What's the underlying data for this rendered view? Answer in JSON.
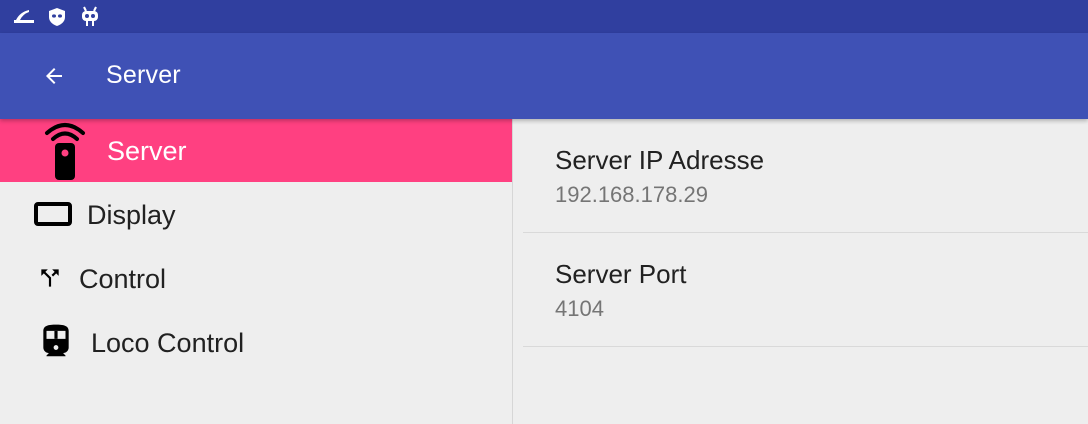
{
  "status_bar": {
    "icons": [
      "signal-strength-icon",
      "privacy-guard-icon",
      "android-debug-icon"
    ]
  },
  "app_bar": {
    "back_icon": "arrow-left-icon",
    "title": "Server"
  },
  "sidebar": {
    "items": [
      {
        "label": "Server",
        "icon": "wireless-remote-icon",
        "active": true
      },
      {
        "label": "Display",
        "icon": "display-icon",
        "active": false
      },
      {
        "label": "Control",
        "icon": "call-split-icon",
        "active": false
      },
      {
        "label": "Loco Control",
        "icon": "train-icon",
        "active": false
      }
    ]
  },
  "preferences": [
    {
      "title": "Server IP Adresse",
      "summary": "192.168.178.29"
    },
    {
      "title": "Server Port",
      "summary": "4104"
    }
  ],
  "colors": {
    "status_bar": "#303f9f",
    "app_bar": "#3f51b5",
    "accent": "#ff4081",
    "background": "#eeeeee"
  }
}
